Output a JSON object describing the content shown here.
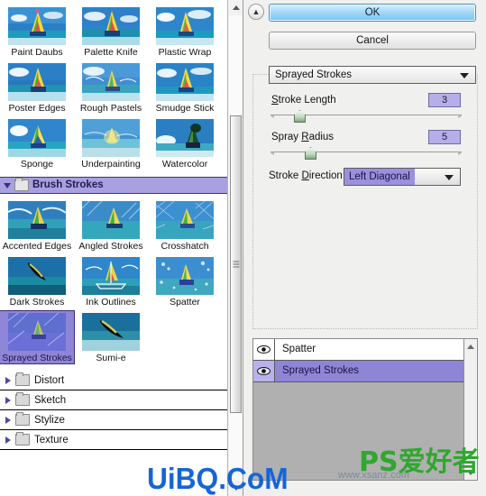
{
  "app": {
    "name": "filter-gallery-dialog",
    "accent_purple": "#8f85d6",
    "accent_blue": "#7cc6f2",
    "panel_bg": "#f0f0ee"
  },
  "browser": {
    "scrollbar": {
      "up_icon": "scroll-up-arrow",
      "down_icon": "scroll-down-arrow",
      "grip_icon": "scrollbar-grip"
    },
    "open_group": {
      "label": "Brush Strokes",
      "expander_icon": "triangle-down-icon",
      "folder_icon": "folder-open-icon"
    },
    "artistic_items": [
      {
        "label": "Paint Daubs",
        "selected": false
      },
      {
        "label": "Palette Knife",
        "selected": false
      },
      {
        "label": "Plastic Wrap",
        "selected": false
      },
      {
        "label": "Poster Edges",
        "selected": false
      },
      {
        "label": "Rough Pastels",
        "selected": false
      },
      {
        "label": "Smudge Stick",
        "selected": false
      },
      {
        "label": "Sponge",
        "selected": false
      },
      {
        "label": "Underpainting",
        "selected": false
      },
      {
        "label": "Watercolor",
        "selected": false
      }
    ],
    "brush_items": [
      {
        "label": "Accented Edges",
        "selected": false
      },
      {
        "label": "Angled Strokes",
        "selected": false
      },
      {
        "label": "Crosshatch",
        "selected": false
      },
      {
        "label": "Dark Strokes",
        "selected": false
      },
      {
        "label": "Ink Outlines",
        "selected": false
      },
      {
        "label": "Spatter",
        "selected": false
      },
      {
        "label": "Sprayed Strokes",
        "selected": true
      },
      {
        "label": "Sumi-e",
        "selected": false
      }
    ],
    "collapsed_groups": [
      {
        "label": "Distort",
        "expander_icon": "triangle-right-icon",
        "folder_icon": "folder-icon"
      },
      {
        "label": "Sketch",
        "expander_icon": "triangle-right-icon",
        "folder_icon": "folder-icon"
      },
      {
        "label": "Stylize",
        "expander_icon": "triangle-right-icon",
        "folder_icon": "folder-icon"
      },
      {
        "label": "Texture",
        "expander_icon": "triangle-right-icon",
        "folder_icon": "folder-icon"
      }
    ]
  },
  "controls": {
    "collapse_icon": "double-chevron-up-icon",
    "ok_label": "OK",
    "cancel_label": "Cancel",
    "filter_select": {
      "value": "Sprayed Strokes",
      "arrow_icon": "chevron-down-icon"
    },
    "stroke_length": {
      "label": "Stroke Length",
      "value": "3",
      "knob_pct": 14
    },
    "spray_radius": {
      "label": "Spray Radius",
      "value": "5",
      "knob_pct": 20
    },
    "stroke_direction": {
      "label": "Stroke Direction:",
      "value": "Left Diagonal",
      "arrow_icon": "chevron-down-icon"
    }
  },
  "layers": {
    "rows": [
      {
        "name": "Spatter",
        "eye_icon": "eye-icon",
        "selected": false
      },
      {
        "name": "Sprayed Strokes",
        "eye_icon": "eye-icon",
        "selected": true
      }
    ],
    "scrollbar": {
      "up_icon": "scroll-up-arrow",
      "down_icon": "scroll-down-arrow"
    }
  },
  "watermark": {
    "blue_text": "UiBQ.CoM",
    "green_text": "PS爱好者",
    "url_text": "www.xsanz.com"
  }
}
